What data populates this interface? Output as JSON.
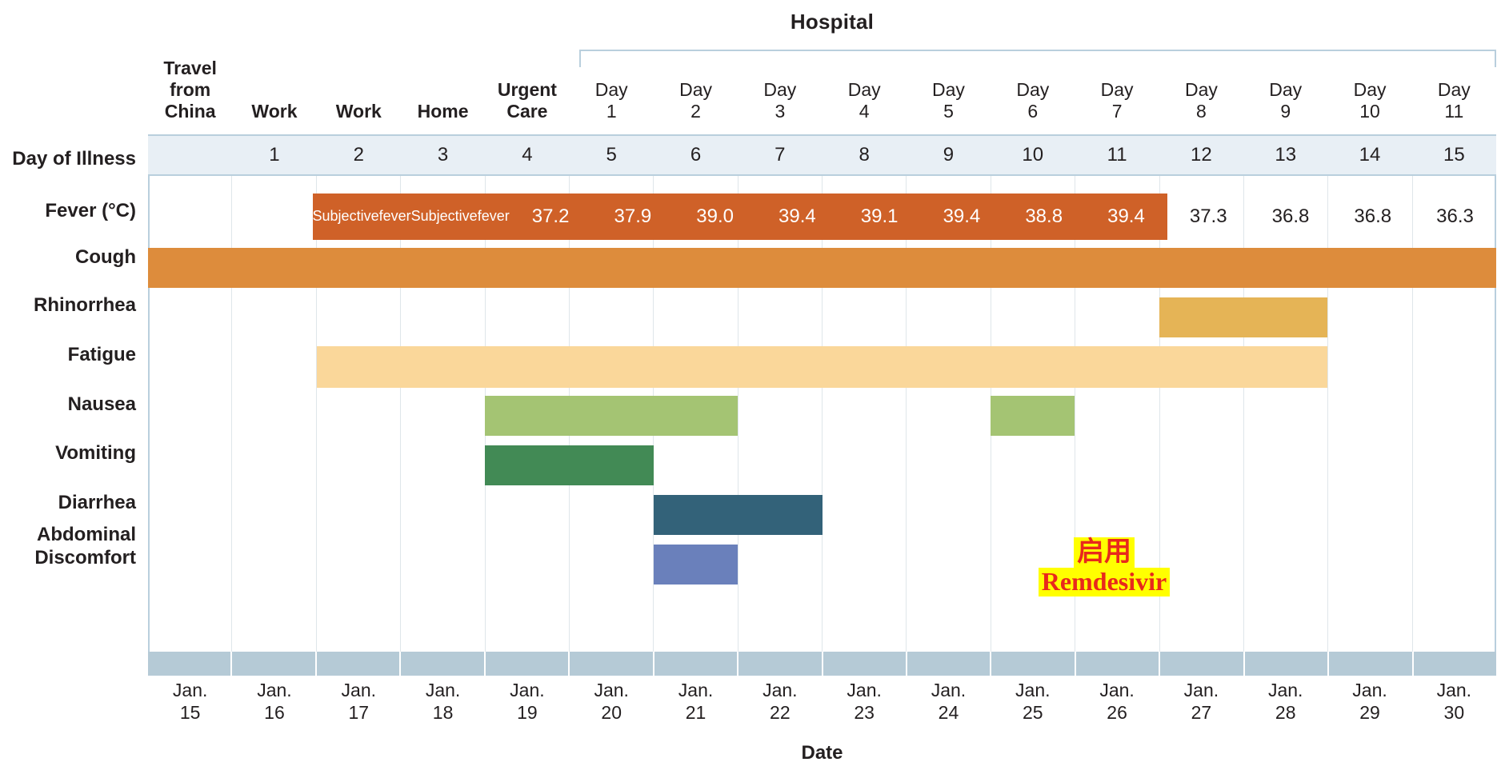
{
  "header": {
    "hospital_label": "Hospital",
    "day_of_illness_label": "Day of Illness",
    "date_axis_label": "Date"
  },
  "columns": [
    {
      "setting": [
        "Travel",
        "from",
        "China"
      ],
      "setting_bold": true,
      "day_of_illness": "",
      "date": [
        "Jan.",
        "15"
      ]
    },
    {
      "setting": [
        "Work"
      ],
      "setting_bold": true,
      "day_of_illness": "1",
      "date": [
        "Jan.",
        "16"
      ]
    },
    {
      "setting": [
        "Work"
      ],
      "setting_bold": true,
      "day_of_illness": "2",
      "date": [
        "Jan.",
        "17"
      ]
    },
    {
      "setting": [
        "Home"
      ],
      "setting_bold": true,
      "day_of_illness": "3",
      "date": [
        "Jan.",
        "18"
      ]
    },
    {
      "setting": [
        "Urgent",
        "Care"
      ],
      "setting_bold": true,
      "day_of_illness": "4",
      "date": [
        "Jan.",
        "19"
      ]
    },
    {
      "setting": [
        "Day",
        "1"
      ],
      "setting_bold": false,
      "day_of_illness": "5",
      "date": [
        "Jan.",
        "20"
      ]
    },
    {
      "setting": [
        "Day",
        "2"
      ],
      "setting_bold": false,
      "day_of_illness": "6",
      "date": [
        "Jan.",
        "21"
      ]
    },
    {
      "setting": [
        "Day",
        "3"
      ],
      "setting_bold": false,
      "day_of_illness": "7",
      "date": [
        "Jan.",
        "22"
      ]
    },
    {
      "setting": [
        "Day",
        "4"
      ],
      "setting_bold": false,
      "day_of_illness": "8",
      "date": [
        "Jan.",
        "23"
      ]
    },
    {
      "setting": [
        "Day",
        "5"
      ],
      "setting_bold": false,
      "day_of_illness": "9",
      "date": [
        "Jan.",
        "24"
      ]
    },
    {
      "setting": [
        "Day",
        "6"
      ],
      "setting_bold": false,
      "day_of_illness": "10",
      "date": [
        "Jan.",
        "25"
      ]
    },
    {
      "setting": [
        "Day",
        "7"
      ],
      "setting_bold": false,
      "day_of_illness": "11",
      "date": [
        "Jan.",
        "26"
      ]
    },
    {
      "setting": [
        "Day",
        "8"
      ],
      "setting_bold": false,
      "day_of_illness": "12",
      "date": [
        "Jan.",
        "27"
      ]
    },
    {
      "setting": [
        "Day",
        "9"
      ],
      "setting_bold": false,
      "day_of_illness": "13",
      "date": [
        "Jan.",
        "28"
      ]
    },
    {
      "setting": [
        "Day",
        "10"
      ],
      "setting_bold": false,
      "day_of_illness": "14",
      "date": [
        "Jan.",
        "29"
      ]
    },
    {
      "setting": [
        "Day",
        "11"
      ],
      "setting_bold": false,
      "day_of_illness": "15",
      "date": [
        "Jan.",
        "30"
      ]
    }
  ],
  "rows": [
    {
      "label": "Fever (°C)"
    },
    {
      "label": "Cough"
    },
    {
      "label": "Rhinorrhea"
    },
    {
      "label": "Fatigue"
    },
    {
      "label": "Nausea"
    },
    {
      "label": "Vomiting"
    },
    {
      "label": "Diarrhea"
    },
    {
      "label": "Abdominal Discomfort",
      "label_lines": [
        "Abdominal",
        "Discomfort"
      ]
    }
  ],
  "annotation": {
    "line_cn": "启用",
    "line_en": "Remdesivir",
    "text_color": "#e8291c",
    "highlight_color": "#ffff00"
  },
  "colors": {
    "fever_fill": "#cf6128",
    "cough_fill": "#dd8c3c",
    "rhinorrhea_fill": "#e5b456",
    "fatigue_fill": "#fad79a",
    "nausea_fill": "#a4c473",
    "vomiting_fill": "#428a55",
    "diarrhea_fill": "#336279",
    "abdominal_fill": "#6a80bb",
    "header_band": "#e8eff5",
    "date_band": "#b5cad6",
    "grid_line": "#dfe6ea",
    "border_line": "#b9cfdd"
  },
  "chart_data": {
    "type": "table",
    "title": "Clinical course of illness — symptoms by date",
    "xlabel": "Date",
    "ylabel": "",
    "x": [
      "Jan. 15",
      "Jan. 16",
      "Jan. 17",
      "Jan. 18",
      "Jan. 19",
      "Jan. 20",
      "Jan. 21",
      "Jan. 22",
      "Jan. 23",
      "Jan. 24",
      "Jan. 25",
      "Jan. 26",
      "Jan. 27",
      "Jan. 28",
      "Jan. 29",
      "Jan. 30"
    ],
    "categories": [
      "Travel from China",
      "Work",
      "Work",
      "Home",
      "Urgent Care",
      "Day 1",
      "Day 2",
      "Day 3",
      "Day 4",
      "Day 5",
      "Day 6",
      "Day 7",
      "Day 8",
      "Day 9",
      "Day 10",
      "Day 11"
    ],
    "day_of_illness": [
      "",
      "1",
      "2",
      "3",
      "4",
      "5",
      "6",
      "7",
      "8",
      "9",
      "10",
      "11",
      "12",
      "13",
      "14",
      "15"
    ],
    "series": [
      {
        "name": "Fever (°C)",
        "type": "value-cells",
        "color": "#cf6128",
        "values": [
          "",
          "",
          "Subjective fever",
          "Subjective fever",
          "37.2",
          "37.9",
          "39.0",
          "39.4",
          "39.1",
          "39.4",
          "38.8",
          "39.4",
          "37.3",
          "36.8",
          "36.8",
          "36.3"
        ],
        "filled": [
          false,
          false,
          true,
          true,
          true,
          true,
          true,
          true,
          true,
          true,
          true,
          true,
          false,
          false,
          false,
          false
        ]
      },
      {
        "name": "Cough",
        "type": "span",
        "color": "#dd8c3c",
        "spans": [
          {
            "start": "Jan. 15",
            "end": "Jan. 30",
            "start_index": 0,
            "end_index": 15
          }
        ]
      },
      {
        "name": "Rhinorrhea",
        "type": "span",
        "color": "#e5b456",
        "spans": [
          {
            "start": "Jan. 27",
            "end": "Jan. 28",
            "start_index": 12,
            "end_index": 13
          }
        ]
      },
      {
        "name": "Fatigue",
        "type": "span",
        "color": "#fad79a",
        "spans": [
          {
            "start": "Jan. 17",
            "end": "Jan. 28",
            "start_index": 2,
            "end_index": 13
          }
        ]
      },
      {
        "name": "Nausea",
        "type": "span",
        "color": "#a4c473",
        "spans": [
          {
            "start": "Jan. 19",
            "end": "Jan. 21",
            "start_index": 4,
            "end_index": 6
          },
          {
            "start": "Jan. 25",
            "end": "Jan. 25",
            "start_index": 10,
            "end_index": 10
          }
        ]
      },
      {
        "name": "Vomiting",
        "type": "span",
        "color": "#428a55",
        "spans": [
          {
            "start": "Jan. 19",
            "end": "Jan. 20",
            "start_index": 4,
            "end_index": 5
          }
        ]
      },
      {
        "name": "Diarrhea",
        "type": "span",
        "color": "#336279",
        "spans": [
          {
            "start": "Jan. 21",
            "end": "Jan. 22",
            "start_index": 6,
            "end_index": 7
          }
        ]
      },
      {
        "name": "Abdominal Discomfort",
        "type": "span",
        "color": "#6a80bb",
        "spans": [
          {
            "start": "Jan. 21",
            "end": "Jan. 21",
            "start_index": 6,
            "end_index": 6
          }
        ]
      }
    ],
    "annotations": [
      {
        "text": "启用 Remdesivir",
        "at_x": "Jan. 26",
        "color": "#e8291c",
        "highlight": "#ffff00"
      }
    ]
  }
}
